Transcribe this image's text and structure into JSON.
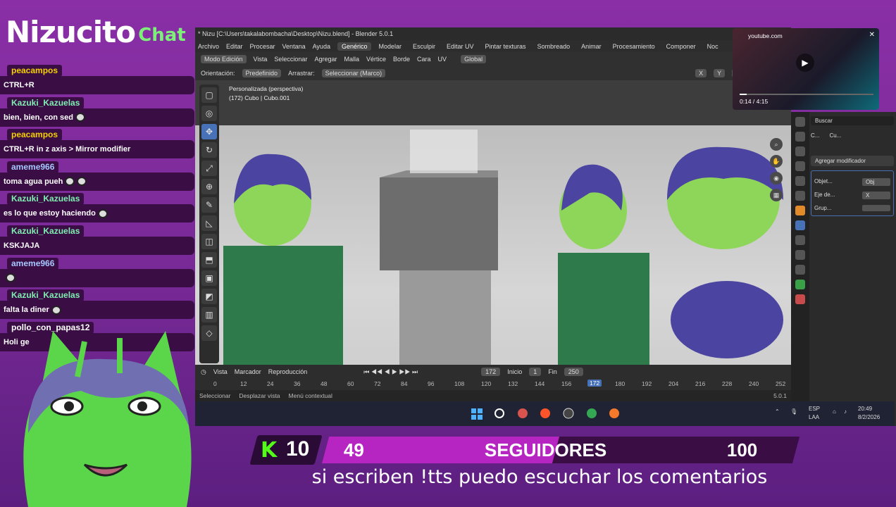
{
  "stream": {
    "brand_main": "Nizucito",
    "brand_sub": "Chat",
    "goal_icon": "K",
    "goal_count": "10",
    "goal_current": "49",
    "goal_label": "SEGUIDORES",
    "goal_target": "100",
    "goal_progress": 0.49,
    "subtitle": "si escriben !tts puedo escuchar los comentarios"
  },
  "chat": {
    "messages": [
      {
        "user": "peacampos",
        "user_color": "#f5d000",
        "text": "CTRL+R",
        "emotes": 0
      },
      {
        "user": "Kazuki_Kazuelas",
        "user_color": "#7ef0b0",
        "text": "bien, bien, con sed",
        "emotes": 1
      },
      {
        "user": "peacampos",
        "user_color": "#f5d000",
        "text": "CTRL+R in z axis > Mirror modifier",
        "emotes": 0
      },
      {
        "user": "ameme966",
        "user_color": "#a7c8ff",
        "text": "toma agua pueh",
        "emotes": 2
      },
      {
        "user": "Kazuki_Kazuelas",
        "user_color": "#7ef0b0",
        "text": "es lo que estoy haciendo",
        "emotes": 1
      },
      {
        "user": "Kazuki_Kazuelas",
        "user_color": "#7ef0b0",
        "text": "KSKJAJA",
        "emotes": 0
      },
      {
        "user": "ameme966",
        "user_color": "#a7c8ff",
        "text": "",
        "emotes": 1
      },
      {
        "user": "Kazuki_Kazuelas",
        "user_color": "#7ef0b0",
        "text": "falta la diner",
        "emotes": 1
      },
      {
        "user": "pollo_con_papas12",
        "user_color": "#ffffff",
        "text": "Holi ge",
        "emotes": 0
      }
    ]
  },
  "blender": {
    "title": "* Nizu [C:\\Users\\takalabombacha\\Desktop\\Nizu.blend] - Blender 5.0.1",
    "menu": [
      "Archivo",
      "Editar",
      "Procesar",
      "Ventana",
      "Ayuda"
    ],
    "workspaces": [
      "Genérico",
      "Modelar",
      "Esculpir",
      "Editar UV",
      "Pintar texturas",
      "Sombreado",
      "Animar",
      "Procesamiento",
      "Componer",
      "Noc"
    ],
    "active_workspace": "Genérico",
    "mode": "Modo Edición",
    "header_menu": [
      "Vista",
      "Seleccionar",
      "Agregar",
      "Malla",
      "Vértice",
      "Borde",
      "Cara",
      "UV"
    ],
    "transform_orientation": "Global",
    "orientation_label": "Orientación:",
    "orientation_value": "Predefinido",
    "drag_label": "Arrastrar:",
    "drag_value": "Seleccionar (Marco)",
    "view_name": "Personalizada (perspectiva)",
    "object_info": "(172) Cubo | Cubo.001",
    "axis_x": "X",
    "axis_y": "Y",
    "axis_z": "Z",
    "timeline_menu": [
      "Vista",
      "Marcador",
      "Reproducción"
    ],
    "current_frame": "172",
    "start_label": "Inicio",
    "start_frame": "1",
    "end_label": "Fin",
    "end_frame": "250",
    "ruler": [
      "0",
      "12",
      "24",
      "36",
      "48",
      "60",
      "72",
      "84",
      "96",
      "108",
      "120",
      "132",
      "144",
      "156",
      "16",
      "180",
      "192",
      "204",
      "216",
      "228",
      "240",
      "252"
    ],
    "status": [
      "Seleccionar",
      "Desplazar vista",
      "Menú contextual"
    ],
    "version": "5.0.1",
    "search_placeholder": "Buscar",
    "props_header_a": "C...",
    "props_header_b": "Cu...",
    "add_modifier": "Agregar modificador",
    "prop_rows": [
      {
        "label": "Objet...",
        "value": "Obj"
      },
      {
        "label": "Eje de...",
        "value": "X"
      },
      {
        "label": "Grup...",
        "value": ""
      }
    ]
  },
  "youtube": {
    "site": "youtube.com",
    "time": "0:14 / 4:15",
    "progress": 0.055
  },
  "tray": {
    "lang": "ESP",
    "region": "LAA",
    "time": "20:49",
    "date": "8/2/2026"
  },
  "colors": {
    "bg": "#8a2fa6",
    "chat_bubble": "#3a0d45",
    "kick_green": "#53fc18",
    "goal_fill": "#b624c2",
    "blender_select": "#4872b8"
  }
}
